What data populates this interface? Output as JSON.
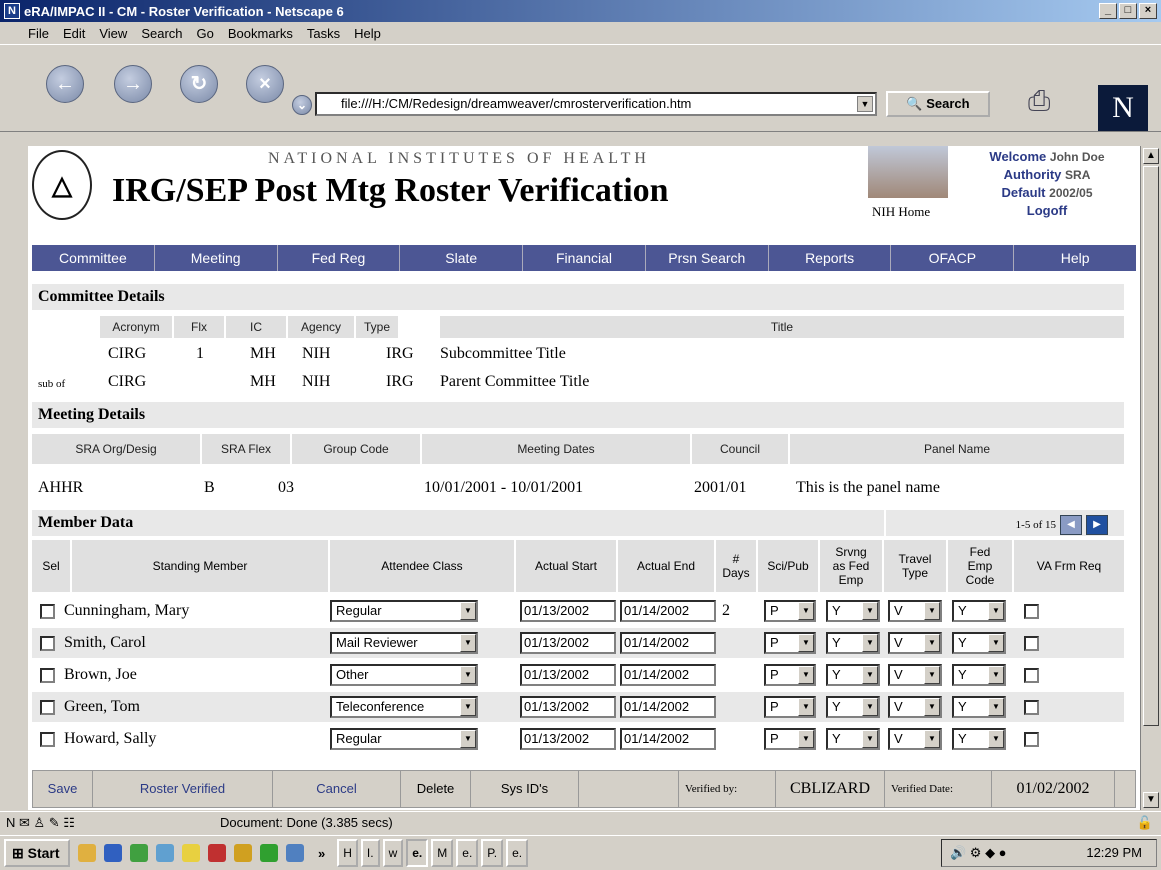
{
  "window": {
    "title": "eRA/IMPAC II - CM - Roster Verification - Netscape 6",
    "app_icon": "N"
  },
  "menu": [
    "File",
    "Edit",
    "View",
    "Search",
    "Go",
    "Bookmarks",
    "Tasks",
    "Help"
  ],
  "browser": {
    "url": "file:///H:/CM/Redesign/dreamweaver/cmrosterverification.htm",
    "search_label": "Search",
    "logo": "N"
  },
  "header": {
    "org": "NATIONAL INSTITUTES OF HEALTH",
    "title": "IRG/SEP Post Mtg Roster Verification",
    "nih_home": "NIH Home",
    "welcome_label": "Welcome",
    "welcome_value": "John Doe",
    "authority_label": "Authority",
    "authority_value": "SRA",
    "default_label": "Default",
    "default_value": "2002/05",
    "logoff": "Logoff"
  },
  "nav": [
    "Committee",
    "Meeting",
    "Fed Reg",
    "Slate",
    "Financial",
    "Prsn Search",
    "Reports",
    "OFACP",
    "Help"
  ],
  "committee": {
    "section_title": "Committee Details",
    "headers": {
      "acronym": "Acronym",
      "flx": "Flx",
      "ic": "IC",
      "agency": "Agency",
      "type": "Type",
      "title": "Title"
    },
    "row1": {
      "acronym": "CIRG",
      "flx": "1",
      "ic": "MH",
      "agency": "NIH",
      "type": "IRG",
      "title": "Subcommittee Title"
    },
    "row2": {
      "prefix": "sub of",
      "acronym": "CIRG",
      "ic": "MH",
      "agency": "NIH",
      "type": "IRG",
      "title": "Parent Committee Title"
    }
  },
  "meeting": {
    "section_title": "Meeting Details",
    "headers": {
      "sra_org": "SRA Org/Desig",
      "sra_flex": "SRA Flex",
      "group_code": "Group Code",
      "dates": "Meeting Dates",
      "council": "Council",
      "panel": "Panel Name"
    },
    "values": {
      "sra_org": "AHHR",
      "sra_flex": "B",
      "group_code": "03",
      "dates": "10/01/2001 - 10/01/2001",
      "council": "2001/01",
      "panel": "This is the panel name"
    }
  },
  "members": {
    "section_title": "Member Data",
    "pager": "1-5 of 15",
    "headers": {
      "sel": "Sel",
      "member": "Standing Member",
      "class": "Attendee Class",
      "start": "Actual Start",
      "end": "Actual End",
      "days": "# Days",
      "scipub": "Sci/Pub",
      "srvng": "Srvng as Fed Emp",
      "travel": "Travel Type",
      "fedemp": "Fed Emp Code",
      "va": "VA Frm Req"
    },
    "rows": [
      {
        "name": "Cunningham, Mary",
        "class": "Regular",
        "start": "01/13/2002",
        "end": "01/14/2002",
        "days": "2",
        "scipub": "P",
        "srvng": "Y",
        "travel": "V",
        "fedemp": "Y"
      },
      {
        "name": "Smith, Carol",
        "class": "Mail Reviewer",
        "start": "01/13/2002",
        "end": "01/14/2002",
        "days": "",
        "scipub": "P",
        "srvng": "Y",
        "travel": "V",
        "fedemp": "Y"
      },
      {
        "name": "Brown, Joe",
        "class": "Other",
        "start": "01/13/2002",
        "end": "01/14/2002",
        "days": "",
        "scipub": "P",
        "srvng": "Y",
        "travel": "V",
        "fedemp": "Y"
      },
      {
        "name": "Green, Tom",
        "class": "Teleconference",
        "start": "01/13/2002",
        "end": "01/14/2002",
        "days": "",
        "scipub": "P",
        "srvng": "Y",
        "travel": "V",
        "fedemp": "Y"
      },
      {
        "name": "Howard, Sally",
        "class": "Regular",
        "start": "01/13/2002",
        "end": "01/14/2002",
        "days": "",
        "scipub": "P",
        "srvng": "Y",
        "travel": "V",
        "fedemp": "Y"
      }
    ]
  },
  "footer": {
    "save": "Save",
    "roster_verified": "Roster Verified",
    "cancel": "Cancel",
    "delete": "Delete",
    "sys_ids": "Sys ID's",
    "verified_by_label": "Verified by:",
    "verified_by_value": "CBLIZARD",
    "verified_date_label": "Verified Date:",
    "verified_date_value": "01/02/2002"
  },
  "status": "Document: Done (3.385 secs)",
  "taskbar": {
    "start": "Start",
    "buttons": [
      "H",
      "I.",
      "w",
      "e.",
      "M",
      "e.",
      "P.",
      "e."
    ],
    "clock": "12:29 PM"
  },
  "colors": {
    "nav_bg": "#4c5694",
    "link": "#2b3a86",
    "title_bar": "#0a246a"
  }
}
